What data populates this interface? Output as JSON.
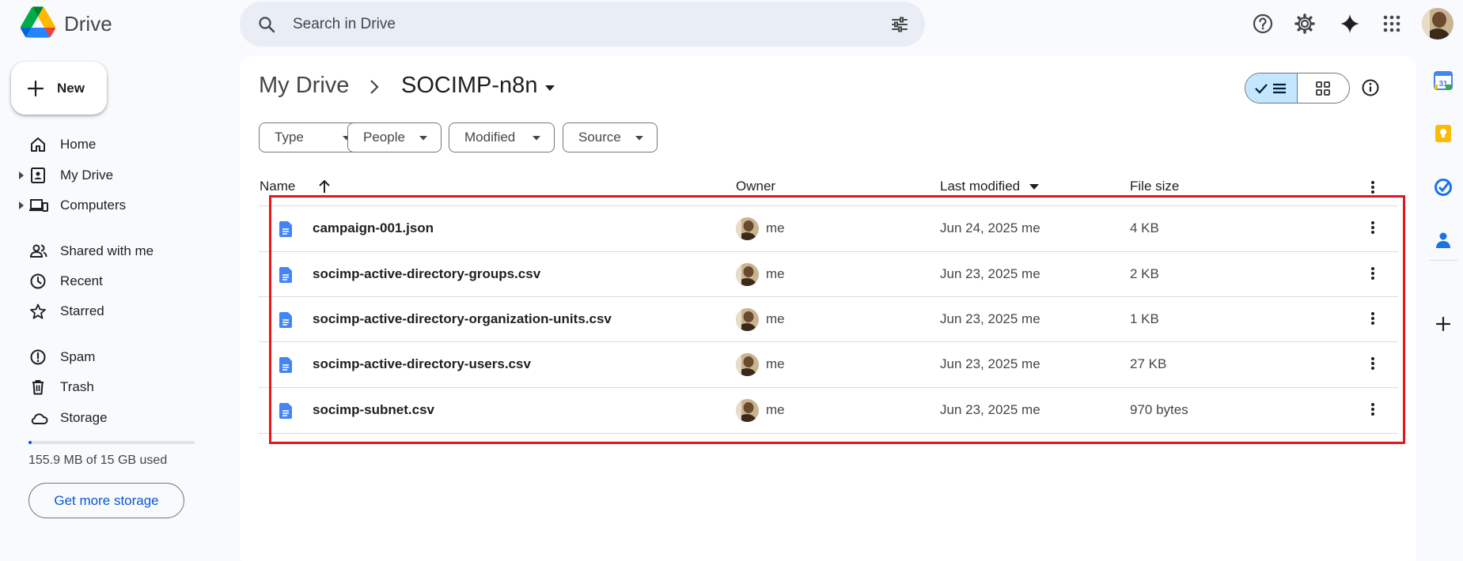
{
  "app": {
    "name": "Drive"
  },
  "search": {
    "placeholder": "Search in Drive"
  },
  "sidebar": {
    "new_label": "New",
    "items": [
      {
        "label": "Home",
        "icon": "home-icon"
      },
      {
        "label": "My Drive",
        "icon": "my-drive-icon"
      },
      {
        "label": "Computers",
        "icon": "computers-icon"
      },
      {
        "label": "Shared with me",
        "icon": "shared-icon"
      },
      {
        "label": "Recent",
        "icon": "clock-icon"
      },
      {
        "label": "Starred",
        "icon": "star-icon"
      },
      {
        "label": "Spam",
        "icon": "spam-icon"
      },
      {
        "label": "Trash",
        "icon": "trash-icon"
      },
      {
        "label": "Storage",
        "icon": "cloud-icon"
      }
    ],
    "storage_used_fraction": 0.01,
    "storage_text": "155.9 MB of 15 GB used",
    "more_storage_label": "Get more storage"
  },
  "breadcrumb": {
    "root": "My Drive",
    "current": "SOCIMP-n8n"
  },
  "filters": [
    "Type",
    "People",
    "Modified",
    "Source"
  ],
  "table": {
    "headers": {
      "name": "Name",
      "owner": "Owner",
      "modified": "Last modified",
      "size": "File size"
    },
    "rows": [
      {
        "name": "campaign-001.json",
        "owner": "me",
        "modified": "Jun 24, 2025 me",
        "size": "4 KB"
      },
      {
        "name": "socimp-active-directory-groups.csv",
        "owner": "me",
        "modified": "Jun 23, 2025 me",
        "size": "2 KB"
      },
      {
        "name": "socimp-active-directory-organization-units.csv",
        "owner": "me",
        "modified": "Jun 23, 2025 me",
        "size": "1 KB"
      },
      {
        "name": "socimp-active-directory-users.csv",
        "owner": "me",
        "modified": "Jun 23, 2025 me",
        "size": "27 KB"
      },
      {
        "name": "socimp-subnet.csv",
        "owner": "me",
        "modified": "Jun 23, 2025 me",
        "size": "970 bytes"
      }
    ]
  },
  "colors": {
    "accent": "#0b57d0",
    "selected_toggle": "#c2e7ff",
    "highlight": "#e8141b",
    "doc_icon": "#4285f4"
  }
}
